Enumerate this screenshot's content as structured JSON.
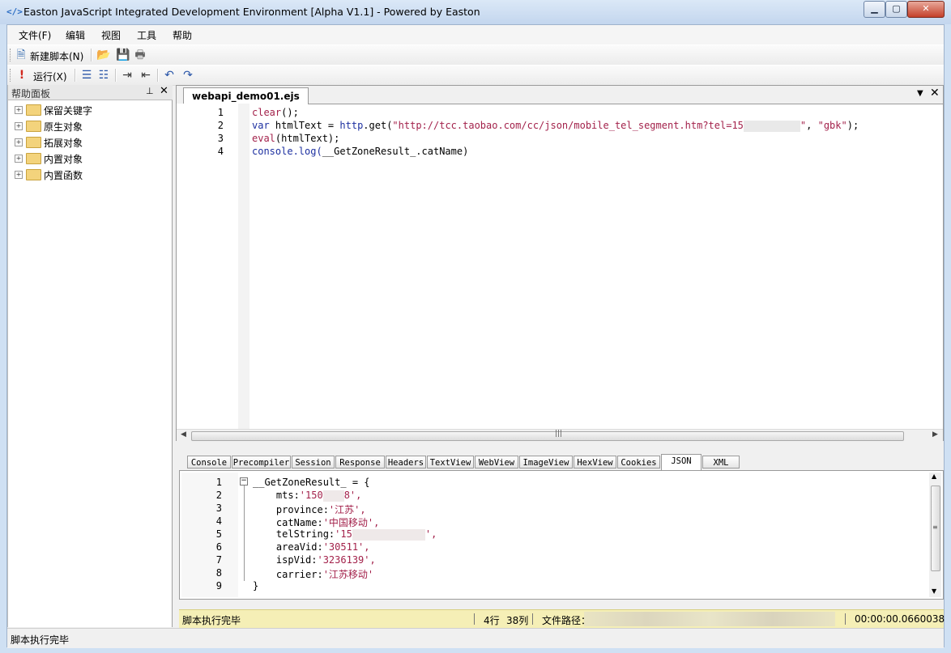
{
  "window": {
    "icon": "</>",
    "title": "Easton JavaScript Integrated Development Environment [Alpha V1.1] - Powered by Easton",
    "min_glyph": "▁",
    "max_glyph": "▢",
    "close_glyph": "✕"
  },
  "menu": [
    "文件(F)",
    "编辑",
    "视图",
    "工具",
    "帮助"
  ],
  "toolbar1": {
    "new_script_label": "新建脚本(N)",
    "icons": [
      "new-script-icon",
      "open-folder-icon",
      "save-icon",
      "print-icon"
    ]
  },
  "toolbar2": {
    "run_label": "运行(X)",
    "icons": [
      "run-icon",
      "indent-list-icon",
      "outdent-list-icon",
      "increase-indent-icon",
      "decrease-indent-icon",
      "undo-icon",
      "redo-icon"
    ]
  },
  "help_panel": {
    "title": "帮助面板",
    "pin_glyph": "📌",
    "close_glyph": "✕",
    "items": [
      "保留关键字",
      "原生对象",
      "拓展对象",
      "内置对象",
      "内置函数"
    ]
  },
  "editor": {
    "tab_label": "webapi_demo01.ejs",
    "line_numbers": [
      "1",
      "2",
      "3",
      "4"
    ],
    "lines": [
      [
        {
          "t": "clear",
          "c": "kw"
        },
        {
          "t": "();",
          "c": "pl"
        }
      ],
      [
        {
          "t": "var ",
          "c": "bl"
        },
        {
          "t": "htmlText = ",
          "c": "pl"
        },
        {
          "t": "http",
          "c": "bl"
        },
        {
          "t": ".get(",
          "c": "pl"
        },
        {
          "t": "\"http://tcc.taobao.com/cc/json/mobile_tel_segment.htm?tel=15",
          "c": "st"
        },
        {
          "t": "",
          "c": "blur"
        },
        {
          "t": "\"",
          "c": "st"
        },
        {
          "t": ", ",
          "c": "pl"
        },
        {
          "t": "\"gbk\"",
          "c": "st"
        },
        {
          "t": ");",
          "c": "pl"
        }
      ],
      [
        {
          "t": "eval",
          "c": "kw"
        },
        {
          "t": "(htmlText);",
          "c": "pl"
        }
      ],
      [
        {
          "t": "console",
          "c": "bl"
        },
        {
          "t": ".log(",
          "c": "bl"
        },
        {
          "t": "__GetZoneResult_.catName",
          "c": "pl"
        },
        {
          "t": ")",
          "c": "pl"
        }
      ]
    ]
  },
  "output_tabs": [
    "Console",
    "Precompiler",
    "Session",
    "Response",
    "Headers",
    "TextView",
    "WebView",
    "ImageView",
    "HexView",
    "Cookies",
    "JSON",
    "XML"
  ],
  "output_active_tab": "JSON",
  "output": {
    "line_numbers": [
      "1",
      "2",
      "3",
      "4",
      "5",
      "6",
      "7",
      "8",
      "9"
    ],
    "lines": [
      [
        {
          "t": "__GetZoneResult_ = {",
          "c": "pl"
        }
      ],
      [
        {
          "t": "    mts:",
          "c": "pl"
        },
        {
          "t": "'150",
          "c": "st"
        },
        {
          "t": "",
          "c": "blur",
          "w": 26
        },
        {
          "t": "8',",
          "c": "st"
        }
      ],
      [
        {
          "t": "    province:",
          "c": "pl"
        },
        {
          "t": "'江苏',",
          "c": "st"
        }
      ],
      [
        {
          "t": "    catName:",
          "c": "pl"
        },
        {
          "t": "'中国移动',",
          "c": "st"
        }
      ],
      [
        {
          "t": "    telString:",
          "c": "pl"
        },
        {
          "t": "'15",
          "c": "st"
        },
        {
          "t": "",
          "c": "blur",
          "w": 90
        },
        {
          "t": "',",
          "c": "st"
        }
      ],
      [
        {
          "t": "    areaVid:",
          "c": "pl"
        },
        {
          "t": "'30511',",
          "c": "st"
        }
      ],
      [
        {
          "t": "    ispVid:",
          "c": "pl"
        },
        {
          "t": "'3236139',",
          "c": "st"
        }
      ],
      [
        {
          "t": "    carrier:",
          "c": "pl"
        },
        {
          "t": "'江苏移动'",
          "c": "st"
        }
      ],
      [
        {
          "t": "}",
          "c": "pl"
        }
      ]
    ]
  },
  "inner_status": {
    "message": "脚本执行完毕",
    "row": "4行",
    "col": "38列",
    "path_label": "文件路径：",
    "elapsed": "00:00:00.0660038"
  },
  "status_bar": {
    "message": "脚本执行完毕"
  },
  "colors": {
    "keyword": "#a3224b",
    "builtin": "#1c2fa0",
    "status_bg": "#f5efb6"
  }
}
